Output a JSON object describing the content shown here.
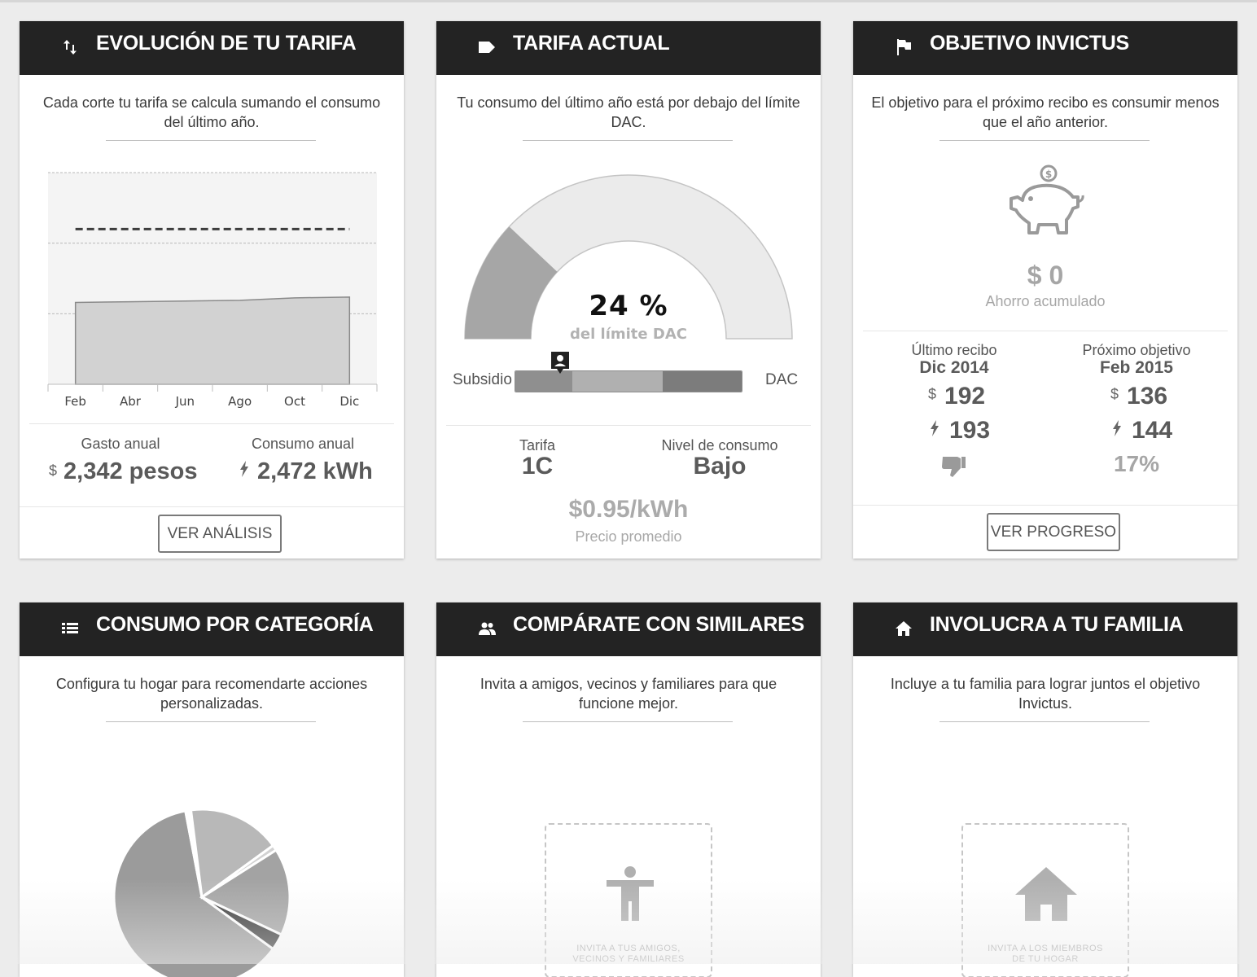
{
  "cards": {
    "evolucion": {
      "title": "EVOLUCIÓN DE TU TARIFA",
      "icon": "sort-arrows-icon",
      "description": "Cada corte tu tarifa se calcula sumando el consumo del último año.",
      "gasto_label": "Gasto anual",
      "gasto_currency": "$",
      "gasto_value": "2,342 pesos",
      "consumo_label": "Consumo anual",
      "consumo_value": "2,472 kWh",
      "button_label": "VER ANÁLISIS"
    },
    "tarifa": {
      "title": "TARIFA ACTUAL",
      "icon": "tag-icon",
      "description": "Tu consumo del último año está por debajo del límite DAC.",
      "gauge_value": "24 %",
      "gauge_fraction": 0.24,
      "gauge_label": "del límite DAC",
      "scale_left": "Subsidio",
      "scale_right": "DAC",
      "scale_marker_fraction": 0.2,
      "tarifa_label": "Tarifa",
      "tarifa_value": "1C",
      "nivel_label": "Nivel de consumo",
      "nivel_value": "Bajo",
      "precio_value": "$0.95/kWh",
      "precio_label": "Precio promedio"
    },
    "objetivo": {
      "title": "OBJETIVO INVICTUS",
      "icon": "flag-icon",
      "description": "El objetivo para el próximo recibo es consumir menos que el año anterior.",
      "ahorro_value": "$ 0",
      "ahorro_label": "Ahorro acumulado",
      "ultimo_label": "Último recibo",
      "ultimo_period": "Dic 2014",
      "ultimo_money": "192",
      "ultimo_kwh": "193",
      "proximo_label": "Próximo objetivo",
      "proximo_period": "Feb 2015",
      "proximo_money": "136",
      "proximo_kwh": "144",
      "proximo_pct": "17%",
      "currency": "$",
      "button_label": "VER PROGRESO"
    },
    "categoria": {
      "title": "CONSUMO POR CATEGORÍA",
      "icon": "list-icon",
      "description": "Configura tu hogar para recomendarte acciones personalizadas."
    },
    "comparate": {
      "title": "COMPÁRATE CON SIMILARES",
      "icon": "people-icon",
      "description": "Invita a amigos, vecinos y familiares para que funcione mejor.",
      "invite_line1": "INVITA A TUS AMIGOS,",
      "invite_line2": "VECINOS Y FAMILIARES"
    },
    "familia": {
      "title": "INVOLUCRA A TU FAMILIA",
      "icon": "home-icon",
      "description": "Incluye a tu familia para lograr juntos el objetivo Invictus.",
      "invite_line1": "INVITA A LOS MIEMBROS",
      "invite_line2": "DE TU HOGAR"
    }
  },
  "chart_data": [
    {
      "type": "area",
      "categories": [
        "Feb",
        "Abr",
        "Jun",
        "Ago",
        "Oct",
        "Dic"
      ],
      "series": [
        {
          "values": [
            2320,
            2340,
            2360,
            2380,
            2450,
            2472
          ]
        }
      ],
      "reference_line": 4400,
      "ylim": [
        0,
        6000
      ],
      "grid": true
    },
    {
      "type": "pie",
      "values": [
        62,
        1,
        17,
        1,
        16,
        3
      ]
    }
  ]
}
